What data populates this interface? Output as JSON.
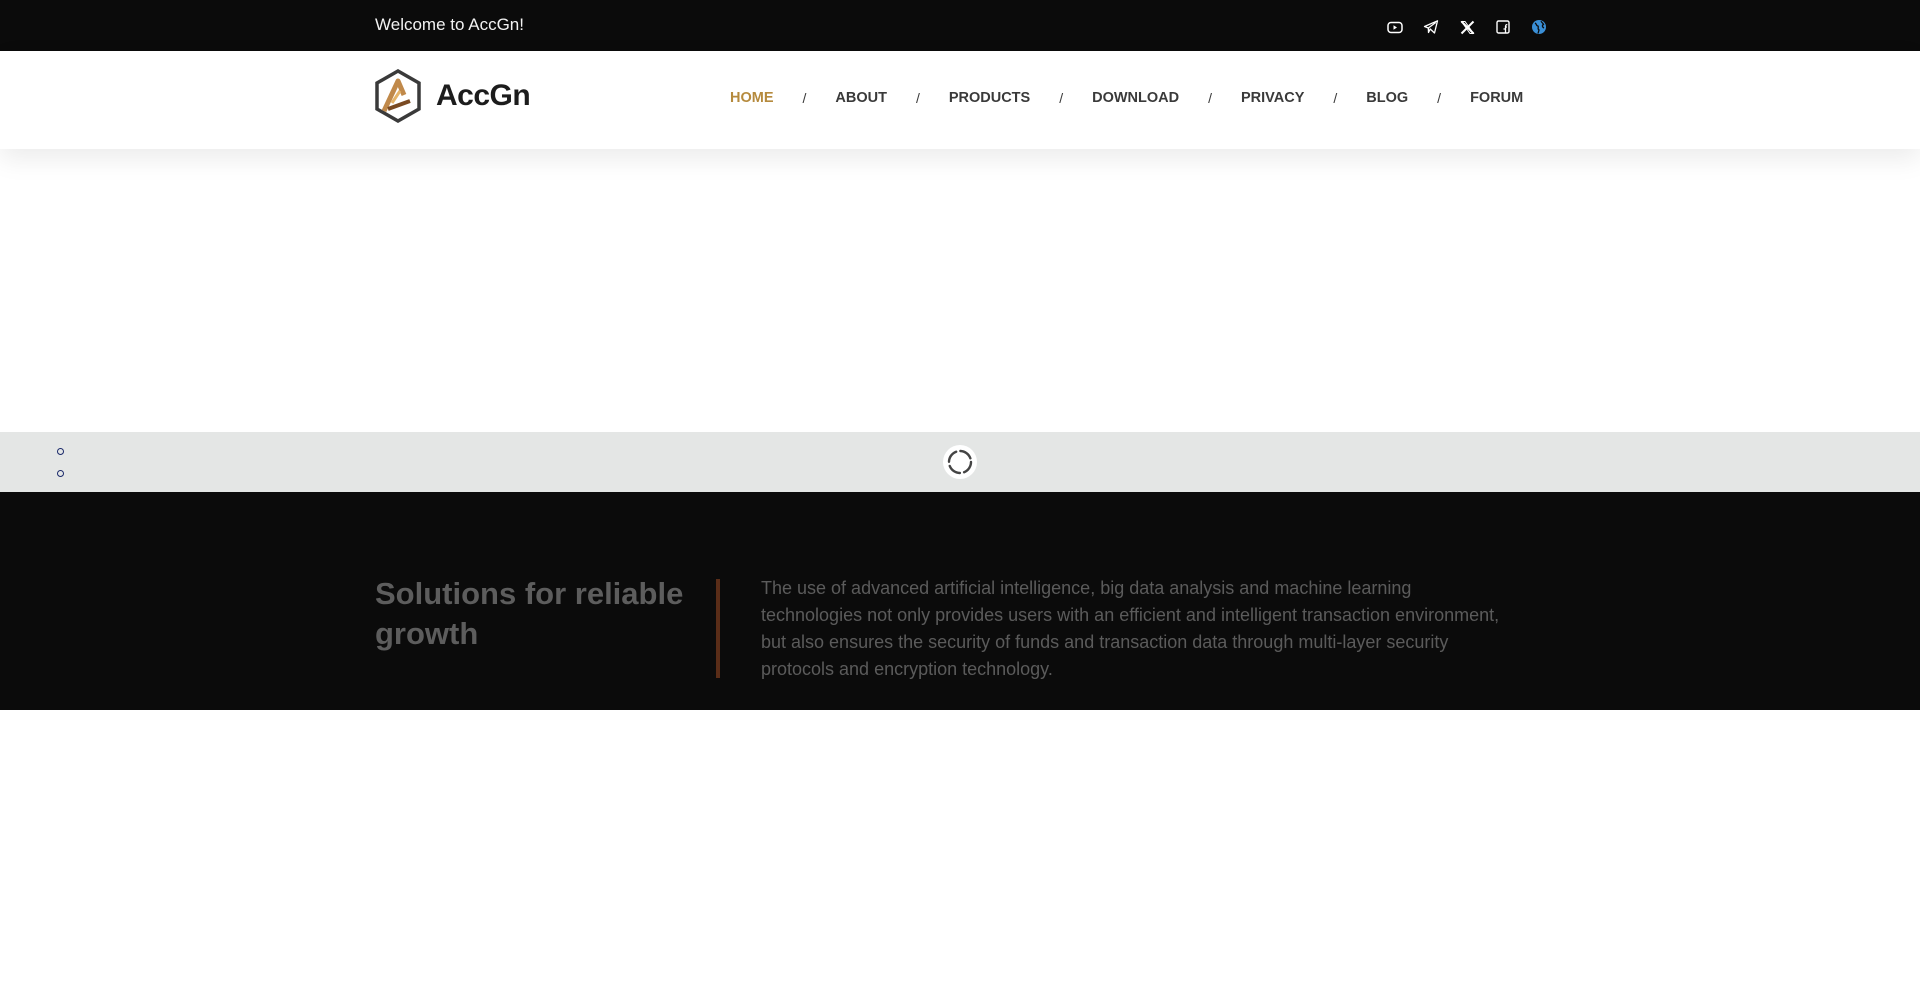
{
  "topbar": {
    "welcome": "Welcome to AccGn!",
    "social": [
      {
        "icon": "youtube-icon"
      },
      {
        "icon": "telegram-icon"
      },
      {
        "icon": "x-icon"
      },
      {
        "icon": "facebook-icon"
      },
      {
        "icon": "globe-icon"
      }
    ]
  },
  "header": {
    "logo_text": "AccGn",
    "nav": [
      {
        "label": "HOME",
        "active": true
      },
      {
        "label": "ABOUT"
      },
      {
        "label": "PRODUCTS"
      },
      {
        "label": "DOWNLOAD"
      },
      {
        "label": "PRIVACY"
      },
      {
        "label": "BLOG"
      },
      {
        "label": "FORUM"
      }
    ],
    "separator": "/"
  },
  "hero": {
    "headline": "Solutions for reliable growth",
    "description": "The use of advanced artificial intelligence, big data analysis and machine learning technologies not only provides users with an efficient and intelligent transaction environment, but also ensures the security of funds and transaction data through multi-layer security protocols and encryption technology."
  },
  "colors": {
    "accent": "#b58a3d",
    "topbar_bg": "#0b0b0b",
    "banner_bg": "#e4e6e5",
    "divider": "#5a2d18"
  }
}
